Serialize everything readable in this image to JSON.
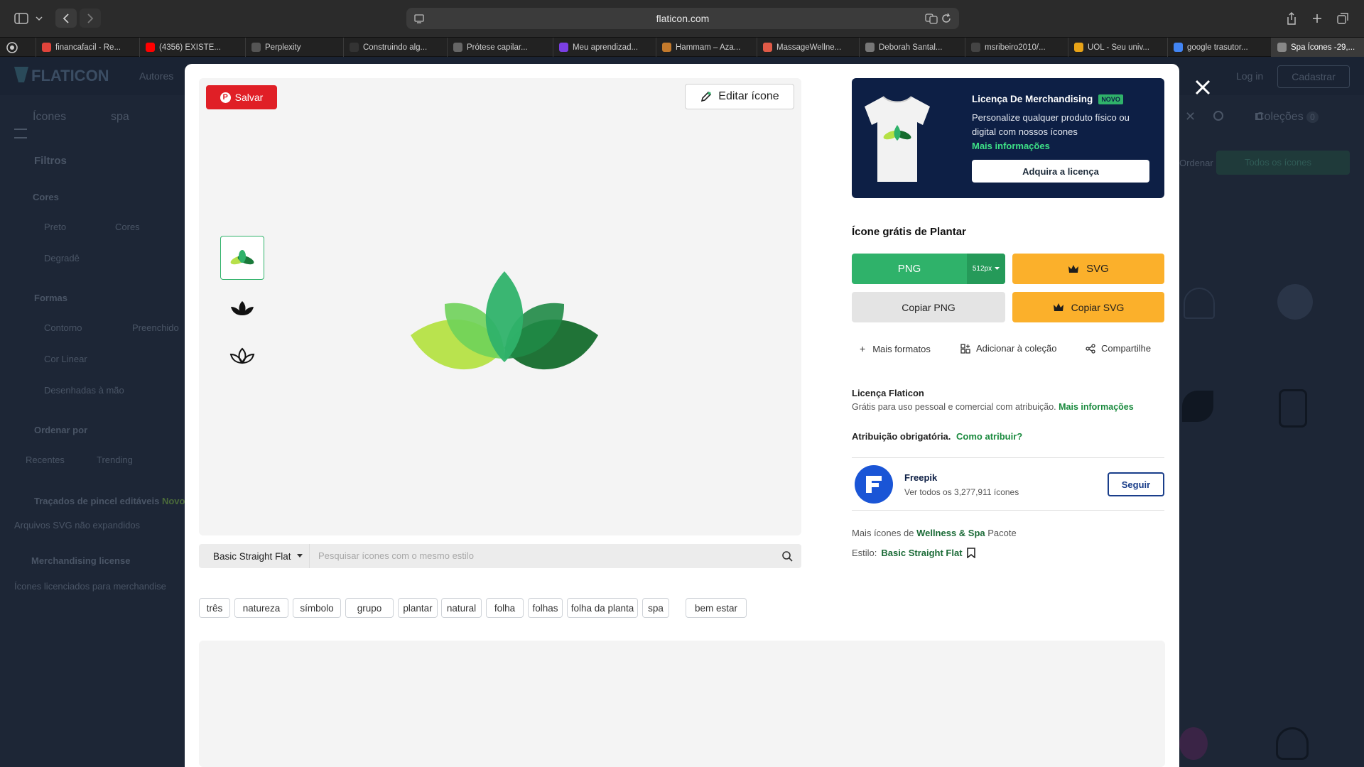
{
  "browser": {
    "url": "flaticon.com",
    "tabs": [
      {
        "label": "financafacil - Re...",
        "color": "#e0443b"
      },
      {
        "label": "(4356) EXISTE...",
        "color": "#ff0000"
      },
      {
        "label": "Perplexity",
        "color": "#555"
      },
      {
        "label": "Construindo alg...",
        "color": "#333"
      },
      {
        "label": "Prótese capilar...",
        "color": "#666"
      },
      {
        "label": "Meu aprendizad...",
        "color": "#7b3fe4"
      },
      {
        "label": "Hammam – Aza...",
        "color": "#c47a2c"
      },
      {
        "label": "MassageWellne...",
        "color": "#e05a47"
      },
      {
        "label": "Deborah Santal...",
        "color": "#777"
      },
      {
        "label": "msribeiro2010/...",
        "color": "#444"
      },
      {
        "label": "UOL - Seu univ...",
        "color": "#e8a317"
      },
      {
        "label": "google trasutor...",
        "color": "#4285f4"
      },
      {
        "label": "Spa Ícones -29,...",
        "color": "#888"
      }
    ]
  },
  "background": {
    "logo": "FLATICON",
    "nav_authors": "Autores",
    "login": "Log in",
    "signup": "Cadastrar",
    "search_category": "Ícones",
    "search_query": "spa",
    "collections": "Coleções",
    "collections_count": "0",
    "sort_label": "Ordenar por:",
    "all_icons": "Todos os ícones",
    "filters": "Filtros",
    "colors_heading": "Cores",
    "color_black": "Preto",
    "color_colors": "Cores",
    "color_gradient": "Degradê",
    "shapes_heading": "Formas",
    "shape_outline": "Contorno",
    "shape_filled": "Preenchido",
    "shape_linear": "Cor Linear",
    "shape_hand": "Desenhadas à mão",
    "order_heading": "Ordenar por",
    "order_recent": "Recentes",
    "order_trending": "Trending",
    "brush": "Traçados de pincel editáveis",
    "brush_badge": "Novo",
    "svg_note": "Arquivos SVG não expandidos",
    "merch": "Merchandising license",
    "merch_note": "Ícones licenciados para merchandise"
  },
  "modal": {
    "save_button": "Salvar",
    "edit_button": "Editar ícone",
    "style_select": "Basic Straight Flat",
    "style_search_placeholder": "Pesquisar ícones com o mesmo estilo",
    "tags": [
      "três",
      "natureza",
      "símbolo",
      "grupo",
      "plantar",
      "natural",
      "folha",
      "folhas",
      "folha da planta",
      "spa",
      "bem estar"
    ],
    "merch_banner": {
      "title": "Licença De Merchandising",
      "badge": "NOVO",
      "desc": "Personalize qualquer produto físico ou digital com nossos ícones",
      "more": "Mais informações",
      "cta": "Adquira a licença"
    },
    "icon_title": "Ícone grátis de Plantar",
    "png_label": "PNG",
    "png_size": "512px",
    "svg_label": "SVG",
    "copy_png": "Copiar PNG",
    "copy_svg": "Copiar SVG",
    "more_formats": "Mais formatos",
    "add_collection": "Adicionar à coleção",
    "share": "Compartilhe",
    "license_title": "Licença Flaticon",
    "license_text": "Grátis para uso pessoal e comercial com atribuição.",
    "license_more": "Mais informações",
    "attribution": "Atribuição obrigatória.",
    "how_attribute": "Como atribuir?",
    "author_name": "Freepik",
    "author_sub": "Ver todos os 3,277,911 ícones",
    "follow": "Seguir",
    "more_icons_prefix": "Mais ícones de",
    "pack_name": "Wellness & Spa",
    "pack_suffix": "Pacote",
    "style_prefix": "Estilo:",
    "style_name": "Basic Straight Flat"
  },
  "colors": {
    "png_green": "#2fb26a",
    "premium_yellow": "#fbb02b",
    "link_green": "#1a8a3e",
    "navy": "#0d1f45"
  }
}
